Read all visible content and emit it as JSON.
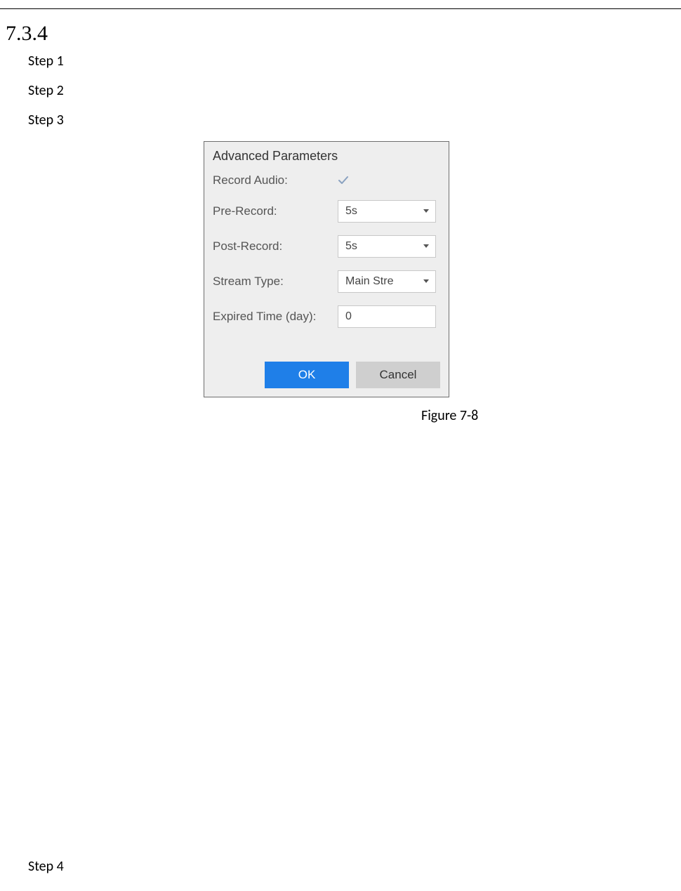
{
  "section_number": "7.3.4",
  "steps": {
    "s1": "Step 1",
    "s2": "Step 2",
    "s3": "Step 3",
    "s4": "Step 4"
  },
  "dialog": {
    "title": "Advanced Parameters",
    "fields": {
      "record_audio_label": "Record Audio:",
      "pre_record_label": "Pre-Record:",
      "pre_record_value": "5s",
      "post_record_label": "Post-Record:",
      "post_record_value": "5s",
      "stream_type_label": "Stream Type:",
      "stream_type_value": "Main Stre",
      "expired_time_label": "Expired Time (day):",
      "expired_time_value": "0"
    },
    "buttons": {
      "ok": "OK",
      "cancel": "Cancel"
    }
  },
  "figure_caption": "Figure 7-8"
}
